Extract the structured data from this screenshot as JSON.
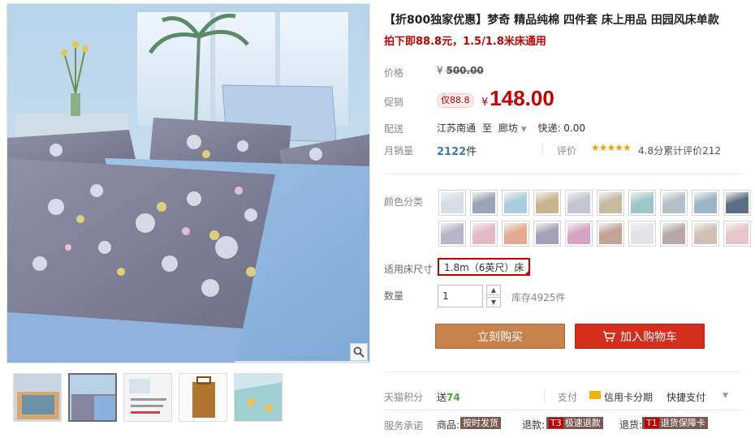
{
  "product": {
    "title": "【折800独家优惠】梦奇 精品纯棉 四件套 床上用品 田园风床单款",
    "subtitle": "拍下即88.8元，1.5/1.8米床通用"
  },
  "price": {
    "label": "价格",
    "currency": "¥",
    "original": "500.00"
  },
  "promo": {
    "label": "促销",
    "tag": "仅88.8",
    "currency": "¥",
    "price": "148.00"
  },
  "shipping": {
    "label": "配送",
    "from": "江苏南通",
    "to_word": "至",
    "destination": "廊坊",
    "fee": "快递: 0.00"
  },
  "sales": {
    "label": "月销量",
    "count": "2122",
    "unit": "件",
    "review_label": "评价",
    "stars": "★★★★★",
    "rating": "4.8分累计评价212"
  },
  "color": {
    "label": "颜色分类",
    "swatches": [
      {
        "name": "swatch-1",
        "color": "#d6dbe6"
      },
      {
        "name": "swatch-2",
        "color": "#9aa3b8"
      },
      {
        "name": "swatch-3",
        "color": "#a9cde0"
      },
      {
        "name": "swatch-4",
        "color": "#c9b48f"
      },
      {
        "name": "swatch-5",
        "color": "#c2c6d4"
      },
      {
        "name": "swatch-6",
        "color": "#c8b9a0"
      },
      {
        "name": "swatch-7",
        "color": "#9cc7c9"
      },
      {
        "name": "swatch-8",
        "color": "#b4bfc8"
      },
      {
        "name": "swatch-9",
        "color": "#9bb6c6"
      },
      {
        "name": "swatch-10",
        "color": "#5a6f85"
      },
      {
        "name": "swatch-11",
        "color": "#b7b3c9"
      },
      {
        "name": "swatch-12",
        "color": "#e3b8c4"
      },
      {
        "name": "swatch-13",
        "color": "#e6a98f"
      },
      {
        "name": "swatch-14",
        "color": "#a6a0b6"
      },
      {
        "name": "swatch-15",
        "color": "#d8a2c2"
      },
      {
        "name": "swatch-16",
        "color": "#c5a196"
      },
      {
        "name": "swatch-17",
        "color": "#e2e2e8"
      },
      {
        "name": "swatch-18",
        "color": "#b8a6a8"
      },
      {
        "name": "swatch-19",
        "color": "#cfc0b3"
      },
      {
        "name": "swatch-20",
        "color": "#e6c4c9"
      }
    ]
  },
  "size": {
    "label": "适用床尺寸",
    "selected": "1.8m（6英尺）床"
  },
  "quantity": {
    "label": "数量",
    "value": "1",
    "up": "▲",
    "down": "▼",
    "stock": "库存4925件"
  },
  "actions": {
    "buy_now": "立刻购买",
    "add_to_cart": "加入购物车"
  },
  "points": {
    "label": "天猫积分",
    "prefix": "送",
    "value": "74"
  },
  "payment": {
    "label": "支付",
    "card": "信用卡分期",
    "quick": "快捷支付"
  },
  "service": {
    "label": "服务承诺",
    "goods_label": "商品:",
    "goods_badge": "按时发货",
    "refund_label": "退款:",
    "refund_tag": "T3",
    "refund_badge": "极速退款",
    "return_label": "退货:",
    "return_tag": "T1",
    "return_badge": "退货保障卡"
  },
  "colors": {
    "accent_red": "#c40000",
    "buy_button": "#c7824c",
    "cart_button": "#d42d1b"
  }
}
